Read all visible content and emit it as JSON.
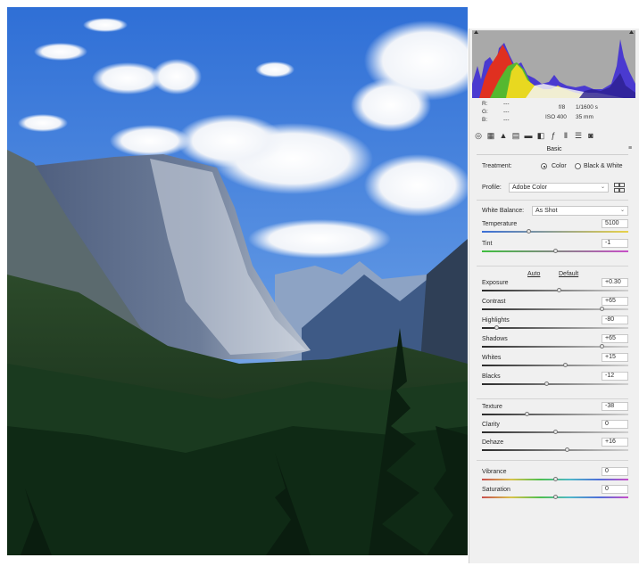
{
  "image": {
    "description_icon": "landscape-photo"
  },
  "histogram": {
    "readout": {
      "r_label": "R:",
      "g_label": "G:",
      "b_label": "B:",
      "r_value": "---",
      "g_value": "---",
      "b_value": "---"
    },
    "exif": {
      "aperture": "f/8",
      "shutter": "1/1600 s",
      "iso": "ISO 400",
      "focal": "35 mm"
    }
  },
  "toolbar": {
    "icons": [
      "basic-icon",
      "tone-curve-icon",
      "detail-icon",
      "hsl-icon",
      "split-toning-icon",
      "lens-icon",
      "effects-icon",
      "calibration-icon",
      "presets-icon",
      "snapshots-icon"
    ]
  },
  "panel": {
    "title": "Basic",
    "treatment": {
      "label": "Treatment:",
      "option_color": "Color",
      "option_bw": "Black & White",
      "selected": "Color"
    },
    "profile": {
      "label": "Profile:",
      "value": "Adobe Color"
    },
    "white_balance": {
      "label": "White Balance:",
      "value": "As Shot"
    },
    "auto_label": "Auto",
    "default_label": "Default",
    "sliders": [
      {
        "key": "temperature",
        "name": "Temperature",
        "value": "5100",
        "position": 0.32
      },
      {
        "key": "tint",
        "name": "Tint",
        "value": "-1",
        "position": 0.5
      },
      {
        "key": "exposure",
        "name": "Exposure",
        "value": "+0.30",
        "position": 0.53
      },
      {
        "key": "contrast",
        "name": "Contrast",
        "value": "+65",
        "position": 0.82
      },
      {
        "key": "highlights",
        "name": "Highlights",
        "value": "-80",
        "position": 0.1
      },
      {
        "key": "shadows",
        "name": "Shadows",
        "value": "+65",
        "position": 0.82
      },
      {
        "key": "whites",
        "name": "Whites",
        "value": "+15",
        "position": 0.57
      },
      {
        "key": "blacks",
        "name": "Blacks",
        "value": "-12",
        "position": 0.44
      },
      {
        "key": "texture",
        "name": "Texture",
        "value": "-38",
        "position": 0.31
      },
      {
        "key": "clarity",
        "name": "Clarity",
        "value": "0",
        "position": 0.5
      },
      {
        "key": "dehaze",
        "name": "Dehaze",
        "value": "+16",
        "position": 0.58
      },
      {
        "key": "vibrance",
        "name": "Vibrance",
        "value": "0",
        "position": 0.5
      },
      {
        "key": "saturation",
        "name": "Saturation",
        "value": "0",
        "position": 0.5
      }
    ]
  },
  "colors": {
    "panel_bg": "#f0f0f0",
    "histogram_bg": "#a9a9a9",
    "temperature_gradient": [
      "#3a6fd8",
      "#e8d24a"
    ],
    "tint_gradient": [
      "#3fbf3f",
      "#c84fc8"
    ]
  }
}
